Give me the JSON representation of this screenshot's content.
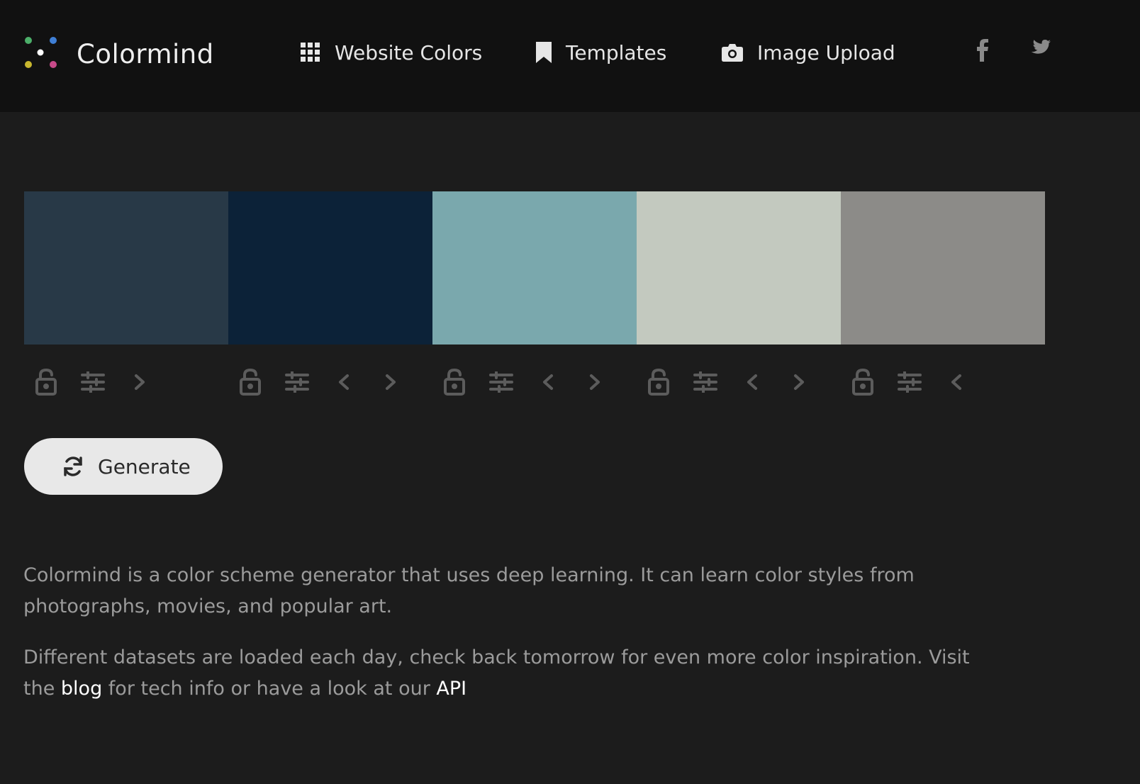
{
  "header": {
    "brand": "Colormind",
    "nav": [
      {
        "label": "Website Colors",
        "icon": "grid-icon"
      },
      {
        "label": "Templates",
        "icon": "bookmark-icon"
      },
      {
        "label": "Image Upload",
        "icon": "camera-icon"
      }
    ],
    "social": [
      {
        "icon": "facebook-icon"
      },
      {
        "icon": "twitter-icon"
      }
    ]
  },
  "palette": {
    "colors": [
      "#283947",
      "#0c2238",
      "#7aa8ad",
      "#c3c9bf",
      "#8c8b88"
    ]
  },
  "generate": {
    "label": "Generate",
    "icon": "refresh-icon"
  },
  "description": {
    "p1": "Colormind is a color scheme generator that uses deep learning. It can learn color styles from photographs, movies, and popular art.",
    "p2_before": "Different datasets are loaded each day, check back tomorrow for even more color inspiration. Visit the ",
    "blog_link": "blog",
    "p2_middle": " for tech info or have a look at our ",
    "api_link": "API"
  }
}
